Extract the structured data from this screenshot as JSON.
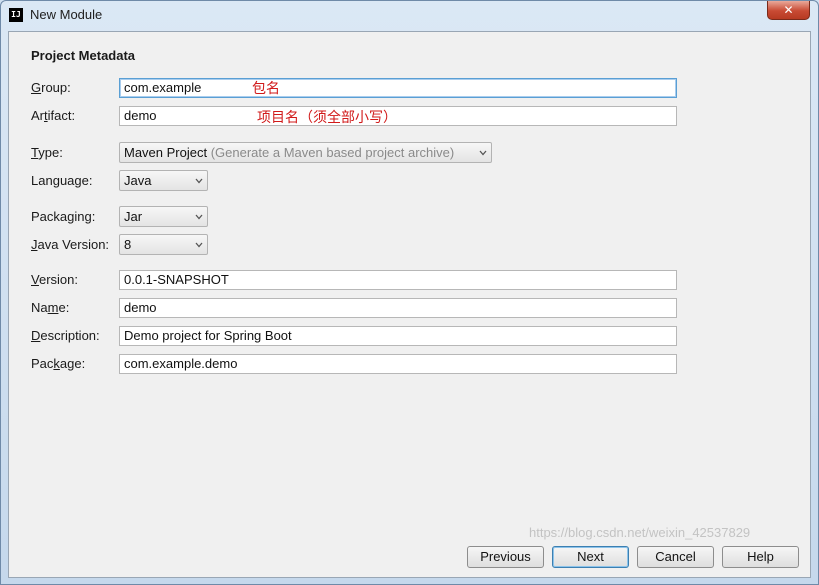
{
  "window": {
    "title": "New Module",
    "app_icon_text": "IJ",
    "close_glyph": "✕"
  },
  "section": {
    "title": "Project Metadata"
  },
  "fields": {
    "group": {
      "label_mnemonic": "G",
      "label_rest": "roup:",
      "value": "com.example"
    },
    "artifact": {
      "label_pre": "Ar",
      "label_mnemonic": "t",
      "label_rest": "ifact:",
      "value": "demo"
    },
    "type": {
      "label_mnemonic": "T",
      "label_rest": "ype:",
      "value": "Maven Project",
      "hint": "(Generate a Maven based project archive)"
    },
    "language": {
      "label_pre": "Lan",
      "label_mnemonic": "g",
      "label_rest": "uage:",
      "value": "Java"
    },
    "packaging": {
      "label_pre": "Packa",
      "label_mnemonic": "g",
      "label_rest": "ing:",
      "value": "Jar"
    },
    "java_version": {
      "label_mnemonic": "J",
      "label_rest": "ava Version:",
      "value": "8"
    },
    "version": {
      "label_mnemonic": "V",
      "label_rest": "ersion:",
      "value": "0.0.1-SNAPSHOT"
    },
    "name": {
      "label_pre": "Na",
      "label_mnemonic": "m",
      "label_rest": "e:",
      "value": "demo"
    },
    "description": {
      "label_mnemonic": "D",
      "label_rest": "escription:",
      "value": "Demo project for Spring Boot"
    },
    "package": {
      "label_pre": "Pac",
      "label_mnemonic": "k",
      "label_rest": "age:",
      "value": "com.example.demo"
    }
  },
  "annotations": {
    "group_note": "包名",
    "artifact_note": "项目名（须全部小写）"
  },
  "buttons": {
    "previous": "Previous",
    "next": "Next",
    "cancel": "Cancel",
    "help": "Help"
  },
  "watermark": "https://blog.csdn.net/weixin_42537829",
  "colors": {
    "annotation": "#d11a1a",
    "focus_border": "#5a9fd4",
    "close_button": "#c84a33"
  }
}
